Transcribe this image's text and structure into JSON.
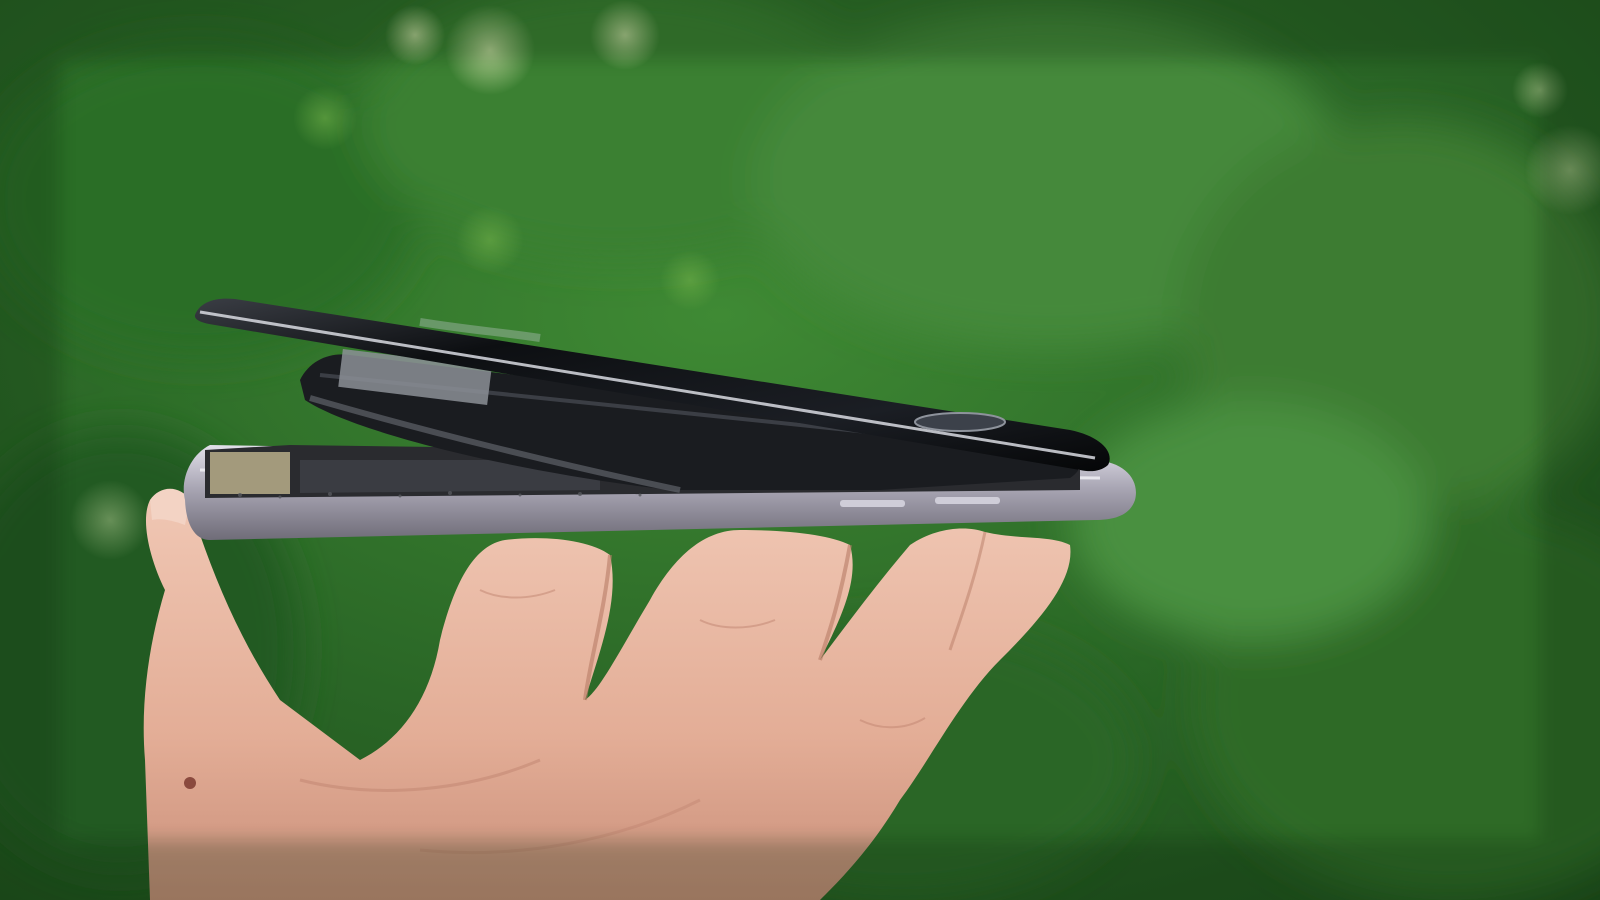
{
  "photo": {
    "subject": "swollen-battery-smartphone-held-in-hand",
    "palette": {
      "bokeh_dark": "#1f4d1c",
      "bokeh_mid": "#3f7f33",
      "bokeh_light": "#8fbf5a",
      "skin": "#e8b9a4",
      "skin_shadow": "#c98f7a",
      "frame_silver": "#b9b6c2",
      "glass_black": "#0d0f12",
      "battery_black": "#1a1c20",
      "internal_gold": "#a39a7c"
    }
  }
}
